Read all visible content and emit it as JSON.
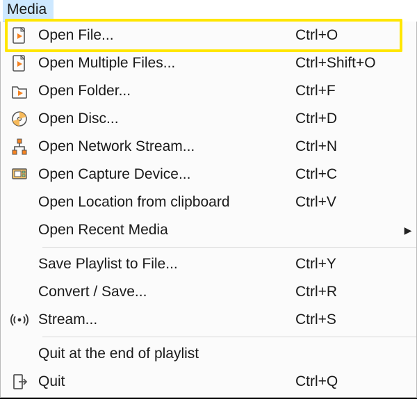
{
  "menu_title": "Media",
  "items": [
    {
      "label": "Open File...",
      "shortcut": "Ctrl+O",
      "icon": "file-play",
      "highlighted": true
    },
    {
      "label": "Open Multiple Files...",
      "shortcut": "Ctrl+Shift+O",
      "icon": "file-play"
    },
    {
      "label": "Open Folder...",
      "shortcut": "Ctrl+F",
      "icon": "folder-play"
    },
    {
      "label": "Open Disc...",
      "shortcut": "Ctrl+D",
      "icon": "disc"
    },
    {
      "label": "Open Network Stream...",
      "shortcut": "Ctrl+N",
      "icon": "network"
    },
    {
      "label": "Open Capture Device...",
      "shortcut": "Ctrl+C",
      "icon": "capture"
    },
    {
      "label": "Open Location from clipboard",
      "shortcut": "Ctrl+V",
      "icon": ""
    },
    {
      "label": "Open Recent Media",
      "shortcut": "",
      "icon": "",
      "submenu": true
    },
    "---",
    {
      "label": "Save Playlist to File...",
      "shortcut": "Ctrl+Y",
      "icon": ""
    },
    {
      "label": "Convert / Save...",
      "shortcut": "Ctrl+R",
      "icon": ""
    },
    {
      "label": "Stream...",
      "shortcut": "Ctrl+S",
      "icon": "stream"
    },
    "---",
    {
      "label": "Quit at the end of playlist",
      "shortcut": "",
      "icon": ""
    },
    {
      "label": "Quit",
      "shortcut": "Ctrl+Q",
      "icon": "quit"
    }
  ]
}
